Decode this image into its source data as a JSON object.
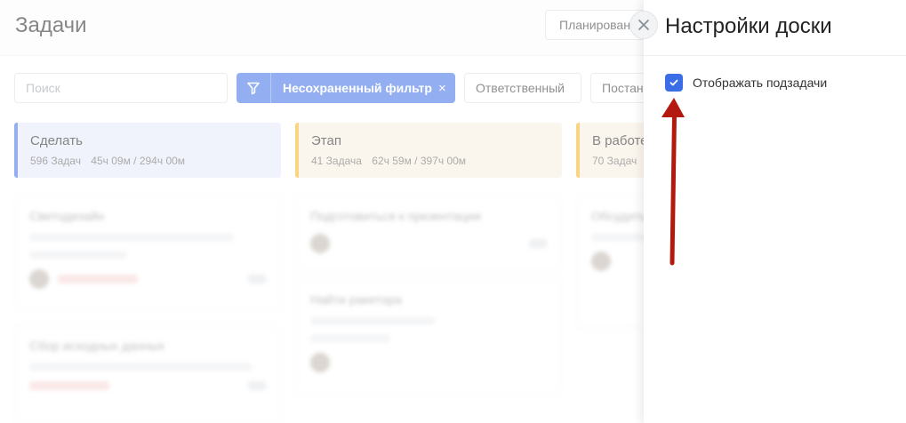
{
  "header": {
    "title": "Задачи",
    "planning_label": "Планирован"
  },
  "filters": {
    "search_placeholder": "Поиск",
    "active_filter_label": "Несохраненный фильтр",
    "active_filter_close": "×",
    "chips": [
      "Ответственный",
      "Постан"
    ]
  },
  "columns": [
    {
      "name": "Сделать",
      "count": "596 Задач",
      "time": "45ч 09м / 294ч 00м",
      "accent": "#3b6ee6"
    },
    {
      "name": "Этап",
      "count": "41 Задача",
      "time": "62ч 59м / 397ч 00м",
      "accent": "#f4b21b"
    },
    {
      "name": "В работе",
      "count": "70 Задач",
      "time": "",
      "accent": "#f4b21b"
    }
  ],
  "cards": [
    {
      "title": "Светодизайн"
    },
    {
      "title": "Сбор исходных данных"
    },
    {
      "title": "Подготовиться к презентации"
    },
    {
      "title": "Найти ракетора"
    },
    {
      "title": "Обсудить"
    }
  ],
  "drawer": {
    "title": "Настройки доски",
    "close_icon": "close-icon",
    "option_label": "Отображать подзадачи",
    "option_checked": true
  },
  "colors": {
    "primary": "#3b6ee6",
    "stage_accent": "#f4b21b",
    "annotation_arrow": "#b3190f"
  }
}
